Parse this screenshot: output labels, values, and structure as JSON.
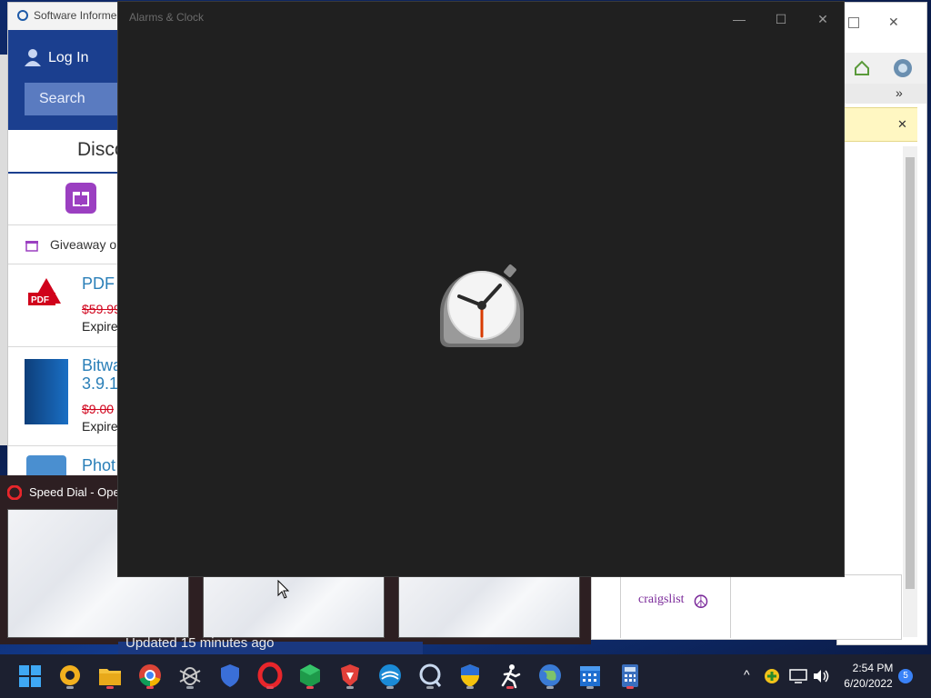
{
  "si_window": {
    "title": "Software Informe",
    "login": "Log In",
    "search_placeholder": "Search",
    "discover": "Disco",
    "giveaway": "Giveaway o",
    "items": [
      {
        "title": "PDF",
        "price": "$59.99",
        "expires": "Expire"
      },
      {
        "title": "Bitwa",
        "subtitle": "3.9.1",
        "price": "$9.00",
        "expires": "Expire"
      },
      {
        "title": "Phot"
      }
    ]
  },
  "clock_window": {
    "title": "Alarms & Clock",
    "minimize": "—",
    "maximize": "☐",
    "close": "✕"
  },
  "thumbnails": {
    "title": "Speed Dial - Oper",
    "updated": "Updated 15 minutes ago"
  },
  "browser_window": {
    "craigslist": "craigslist",
    "peace": "☮",
    "notif_close": "✕",
    "more": "»"
  },
  "taskbar": {
    "icons": [
      "start-icon",
      "opera-gx-icon",
      "file-explorer-icon",
      "chrome-icon",
      "bug-icon",
      "shield-icon",
      "opera-icon",
      "cube-icon",
      "brave-icon",
      "speedtest-icon",
      "qbittorrent-icon",
      "uac-shield-icon",
      "runner-icon",
      "globe-icon",
      "calendar-icon",
      "calculator-icon"
    ],
    "time": "2:54 PM",
    "date": "6/20/2022",
    "notifications": "5",
    "chevron": "^"
  },
  "colors": {
    "clock_bg": "#202020",
    "taskbar_bg": "#1c2030",
    "si_blue": "#1b3f8f"
  }
}
